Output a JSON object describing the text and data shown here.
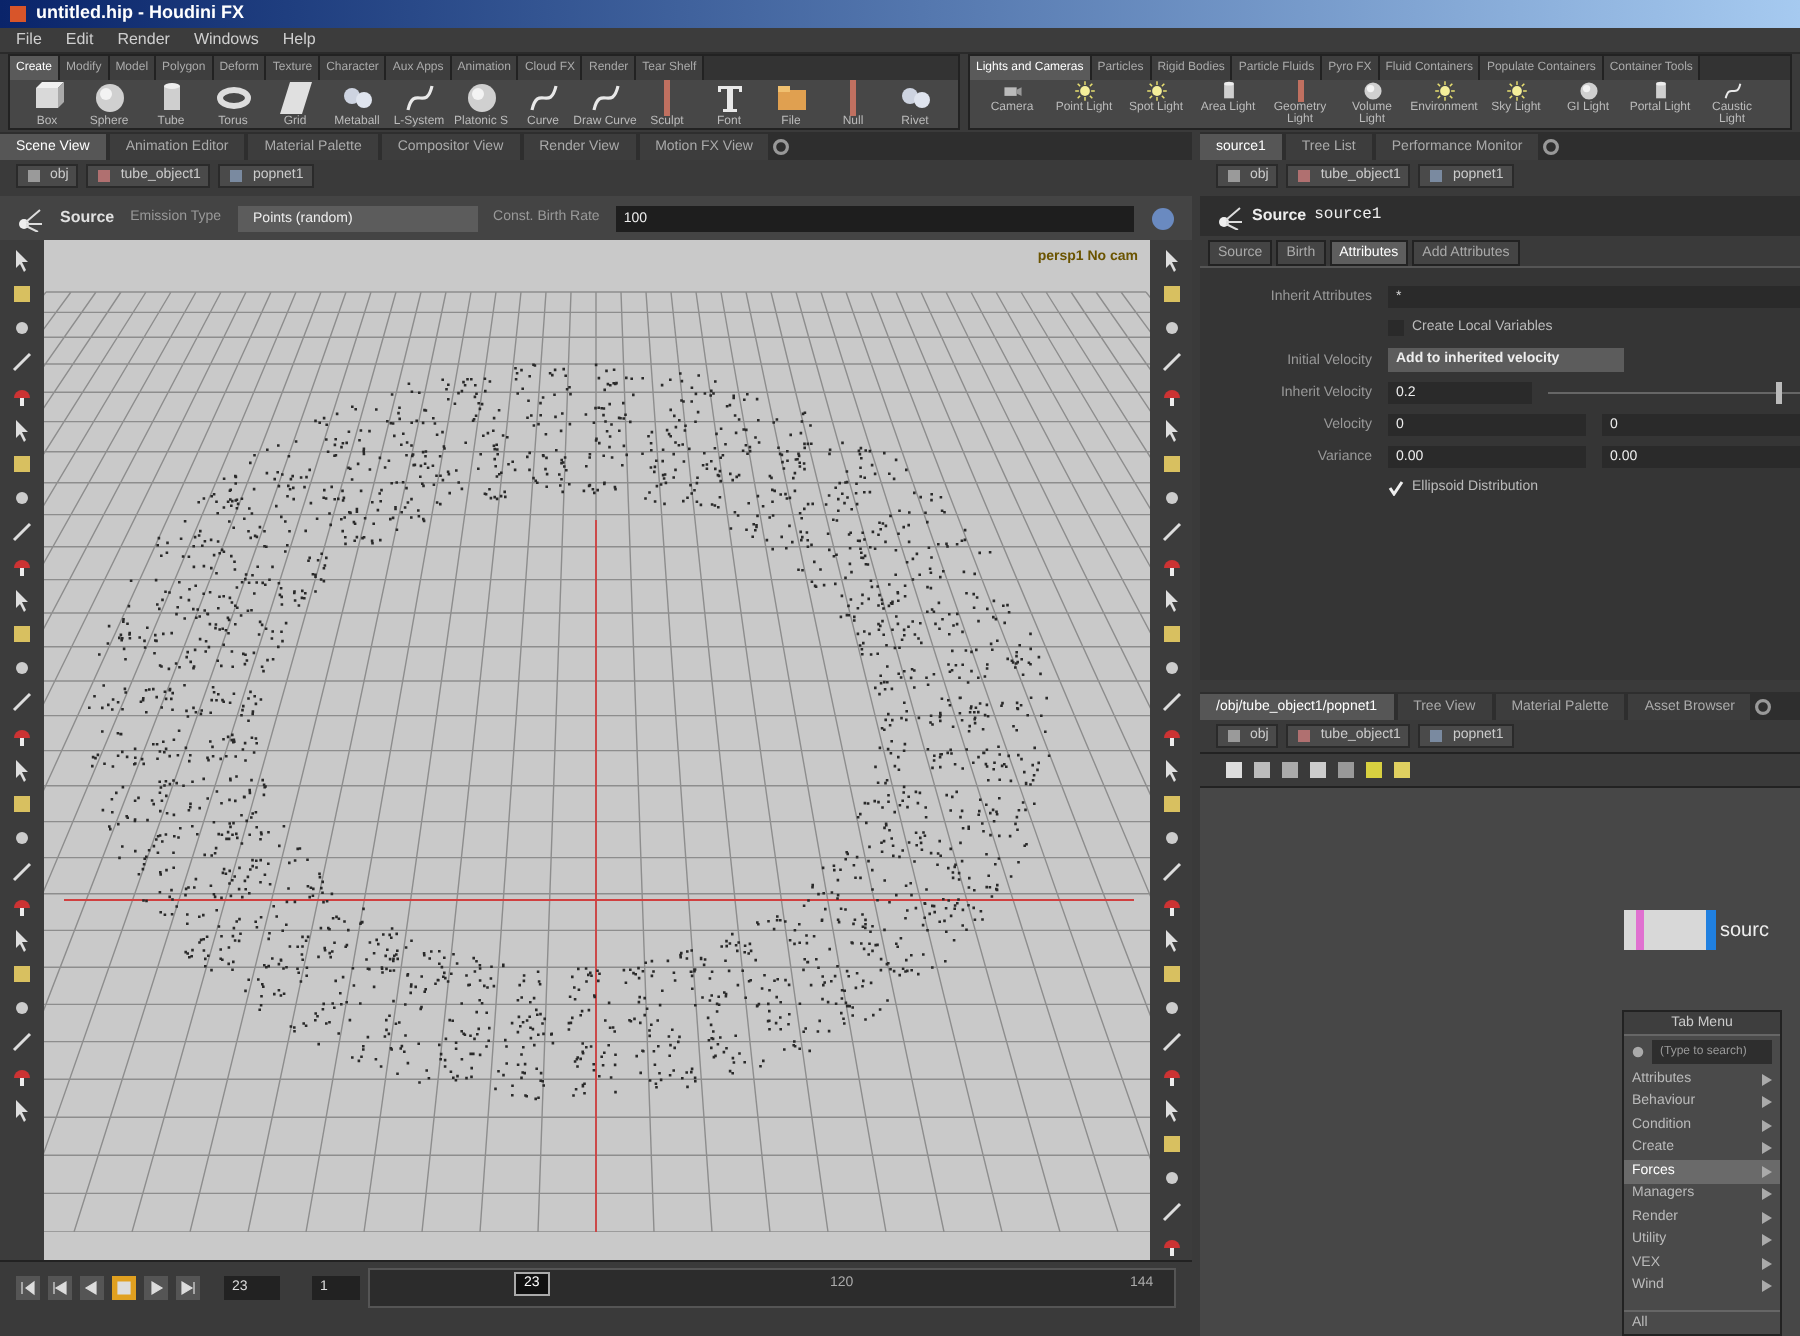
{
  "window": {
    "title": "untitled.hip - Houdini FX"
  },
  "menu": [
    "File",
    "Edit",
    "Render",
    "Windows",
    "Help"
  ],
  "shelf_left": {
    "tabs": [
      {
        "label": "Create",
        "selected": true
      },
      {
        "label": "Modify",
        "selected": false
      },
      {
        "label": "Model",
        "selected": false
      },
      {
        "label": "Polygon",
        "selected": false
      },
      {
        "label": "Deform",
        "selected": false
      },
      {
        "label": "Texture",
        "selected": false
      },
      {
        "label": "Character",
        "selected": false
      },
      {
        "label": "Aux Apps",
        "selected": false
      },
      {
        "label": "Animation",
        "selected": false
      },
      {
        "label": "Cloud FX",
        "selected": false
      },
      {
        "label": "Render",
        "selected": false
      },
      {
        "label": "Tear Shelf",
        "selected": false
      }
    ],
    "tools": [
      "Box",
      "Sphere",
      "Tube",
      "Torus",
      "Grid",
      "Metaball",
      "L-System",
      "Platonic S",
      "Curve",
      "Draw Curve",
      "Sculpt",
      "Font",
      "File",
      "Null",
      "Rivet"
    ]
  },
  "shelf_right": {
    "tabs": [
      {
        "label": "Lights and Cameras",
        "selected": true
      },
      {
        "label": "Particles",
        "selected": false
      },
      {
        "label": "Rigid Bodies",
        "selected": false
      },
      {
        "label": "Particle Fluids",
        "selected": false
      },
      {
        "label": "Pyro FX",
        "selected": false
      },
      {
        "label": "Fluid Containers",
        "selected": false
      },
      {
        "label": "Populate Containers",
        "selected": false
      },
      {
        "label": "Container Tools",
        "selected": false
      }
    ],
    "tools": [
      "Camera",
      "Point Light",
      "Spot Light",
      "Area Light",
      "Geometry Light",
      "Volume Light",
      "Environment",
      "Sky Light",
      "GI Light",
      "Portal Light",
      "Caustic Light"
    ]
  },
  "viewer": {
    "tabs": [
      {
        "label": "Scene View",
        "selected": true
      },
      {
        "label": "Animation Editor",
        "selected": false
      },
      {
        "label": "Material Palette",
        "selected": false
      },
      {
        "label": "Compositor View",
        "selected": false
      },
      {
        "label": "Render View",
        "selected": false
      },
      {
        "label": "Motion FX View",
        "selected": false
      }
    ],
    "path": [
      "obj",
      "tube_object1",
      "popnet1"
    ],
    "operator": "Source",
    "params": [
      {
        "label": "Emission Type",
        "value": "Points (random)"
      },
      {
        "label": "Const. Birth Rate",
        "value": "100"
      }
    ],
    "camera_label": "persp1  No cam"
  },
  "timeline": {
    "frame": "23",
    "step": "1",
    "marker": "23",
    "ticks": [
      "120",
      "144"
    ]
  },
  "parameters": {
    "tabs": [
      {
        "label": "source1",
        "selected": true
      },
      {
        "label": "Tree List",
        "selected": false
      },
      {
        "label": "Performance Monitor",
        "selected": false
      }
    ],
    "path": [
      "obj",
      "tube_object1",
      "popnet1"
    ],
    "node_type": "Source",
    "node_name": "source1",
    "param_tabs": [
      {
        "label": "Source",
        "selected": false
      },
      {
        "label": "Birth",
        "selected": false
      },
      {
        "label": "Attributes",
        "selected": true
      },
      {
        "label": "Add Attributes",
        "selected": false
      }
    ],
    "rows": [
      {
        "kind": "text",
        "label": "Inherit Attributes",
        "value": "*"
      },
      {
        "kind": "checkbox",
        "label": "Create Local Variables",
        "checked": false
      },
      {
        "kind": "menu",
        "label": "Initial Velocity",
        "value": "Add to inherited velocity"
      },
      {
        "kind": "slider",
        "label": "Inherit Velocity",
        "value": "0.2",
        "level": 0.92
      },
      {
        "kind": "vector",
        "label": "Velocity",
        "values": [
          "0",
          "0"
        ]
      },
      {
        "kind": "vector",
        "label": "Variance",
        "values": [
          "0.00",
          "0.00"
        ]
      },
      {
        "kind": "checkbox",
        "label": "Ellipsoid Distribution",
        "checked": true
      }
    ]
  },
  "network": {
    "tabs": [
      {
        "label": "/obj/tube_object1/popnet1",
        "selected": true
      },
      {
        "label": "Tree View",
        "selected": false
      },
      {
        "label": "Material Palette",
        "selected": false
      },
      {
        "label": "Asset Browser",
        "selected": false
      }
    ],
    "path": [
      "obj",
      "tube_object1",
      "popnet1"
    ],
    "node": {
      "name": "sourc"
    },
    "tab_menu": {
      "title": "Tab Menu",
      "placeholder": "(Type to search)",
      "items": [
        {
          "label": "Attributes",
          "selected": false
        },
        {
          "label": "Behaviour",
          "selected": false
        },
        {
          "label": "Condition",
          "selected": false
        },
        {
          "label": "Create",
          "selected": false
        },
        {
          "label": "Forces",
          "selected": true
        },
        {
          "label": "Managers",
          "selected": false
        },
        {
          "label": "Render",
          "selected": false
        },
        {
          "label": "Utility",
          "selected": false
        },
        {
          "label": "VEX",
          "selected": false
        },
        {
          "label": "Wind",
          "selected": false
        }
      ],
      "all": "All"
    }
  }
}
